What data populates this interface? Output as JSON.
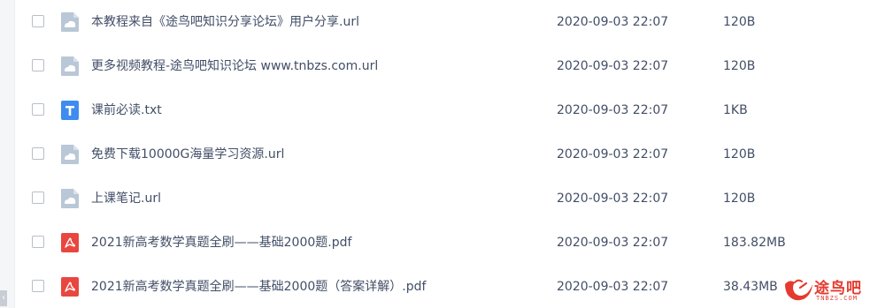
{
  "files": [
    {
      "name": "本教程来自《途鸟吧知识分享论坛》用户分享.url",
      "date": "2020-09-03 22:07",
      "size": "120B",
      "icon": "url-file-icon"
    },
    {
      "name": "更多视频教程-途鸟吧知识论坛 www.tnbzs.com.url",
      "date": "2020-09-03 22:07",
      "size": "120B",
      "icon": "url-file-icon"
    },
    {
      "name": "课前必读.txt",
      "date": "2020-09-03 22:07",
      "size": "1KB",
      "icon": "txt-file-icon"
    },
    {
      "name": "免费下载10000G海量学习资源.url",
      "date": "2020-09-03 22:07",
      "size": "120B",
      "icon": "url-file-icon"
    },
    {
      "name": "上课笔记.url",
      "date": "2020-09-03 22:07",
      "size": "120B",
      "icon": "url-file-icon"
    },
    {
      "name": "2021新高考数学真题全刷——基础2000题.pdf",
      "date": "2020-09-03 22:07",
      "size": "183.82MB",
      "icon": "pdf-file-icon"
    },
    {
      "name": "2021新高考数学真题全刷——基础2000题（答案详解）.pdf",
      "date": "2020-09-03 22:07",
      "size": "38.43MB",
      "icon": "pdf-file-icon"
    }
  ],
  "watermark": {
    "text": "途鸟吧",
    "sub": "TNBZS.COM"
  },
  "colors": {
    "url_icon": "#b9c7d6",
    "txt_icon": "#3f8cf0",
    "pdf_icon": "#e8473f",
    "text": "#424e67",
    "watermark": "#e53a2f"
  }
}
